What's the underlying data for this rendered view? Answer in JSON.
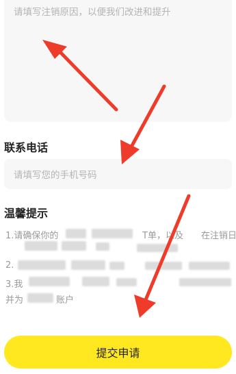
{
  "form": {
    "reason_placeholder": "请填写注销原因，以便我们改进和提升",
    "phone_label": "联系电话",
    "phone_placeholder": "请填写您的手机号码"
  },
  "tips": {
    "title": "温馨提示",
    "line1_start": "1.请确保你的",
    "line1_mid": "T单，以及",
    "line1_end": "在注销日",
    "line2_start": "2.",
    "line3_start": "3.我",
    "line4_start": "并为",
    "line4_end": "账户"
  },
  "submit": {
    "label": "提交申请"
  },
  "colors": {
    "accent_yellow": "#ffe81f",
    "arrow_red": "#ee3b2a"
  }
}
